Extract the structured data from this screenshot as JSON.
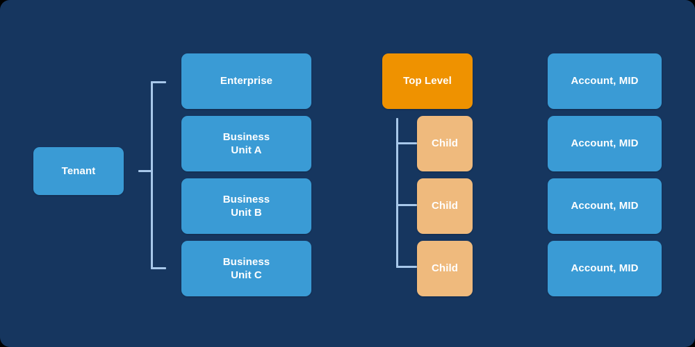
{
  "diagram": {
    "background_color": "#16365f",
    "accent_blue": "#3a9bd5",
    "accent_orange": "#ef9200",
    "accent_tan": "#efba7d",
    "connector_color": "#a8c8ea",
    "columns": [
      {
        "name": "tenant-column",
        "nodes": [
          {
            "label": "Tenant",
            "color": "#3a9bd5"
          }
        ]
      },
      {
        "name": "organization-column",
        "nodes": [
          {
            "label": "Enterprise",
            "color": "#3a9bd5"
          },
          {
            "label": "Business\nUnit A",
            "color": "#3a9bd5"
          },
          {
            "label": "Business\nUnit B",
            "color": "#3a9bd5"
          },
          {
            "label": "Business\nUnit C",
            "color": "#3a9bd5"
          }
        ]
      },
      {
        "name": "hierarchy-column",
        "nodes": [
          {
            "label": "Top Level",
            "color": "#ef9200"
          },
          {
            "label": "Child",
            "color": "#efba7d"
          },
          {
            "label": "Child",
            "color": "#efba7d"
          },
          {
            "label": "Child",
            "color": "#efba7d"
          }
        ]
      },
      {
        "name": "account-column",
        "nodes": [
          {
            "label": "Account, MID",
            "color": "#3a9bd5"
          },
          {
            "label": "Account, MID",
            "color": "#3a9bd5"
          },
          {
            "label": "Account, MID",
            "color": "#3a9bd5"
          },
          {
            "label": "Account, MID",
            "color": "#3a9bd5"
          }
        ]
      }
    ]
  }
}
